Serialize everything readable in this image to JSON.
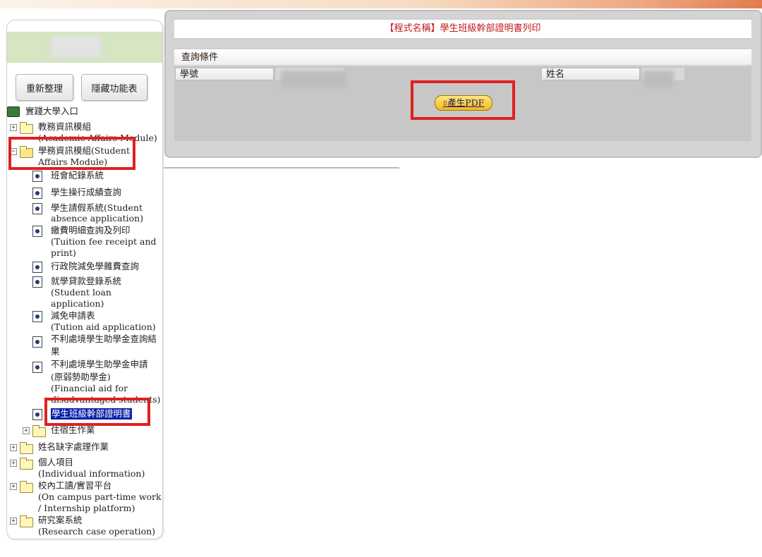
{
  "sidebar": {
    "refresh_label": "重新整理",
    "hide_menu_label": "隱藏功能表",
    "root_label": "實踐大學入口",
    "items": [
      {
        "label": "教務資訊模組",
        "sub": "(Academic Affairs Module)"
      },
      {
        "label": "學務資訊模組(Student",
        "sub": "Affairs Module)"
      },
      {
        "label": "班會紀錄系統"
      },
      {
        "label": "學生操行成績查詢"
      },
      {
        "label": "學生請假系統(Student",
        "sub": "absence application)"
      },
      {
        "label": "繳費明細查詢及列印",
        "sub": "(Tuition fee receipt and",
        "sub2": "print)"
      },
      {
        "label": "行政院減免學雜費查詢"
      },
      {
        "label": "就學貸款登錄系統",
        "sub": "(Student loan",
        "sub2": "application)"
      },
      {
        "label": "減免申請表",
        "sub": "(Tution aid application)"
      },
      {
        "label": "不利處境學生助學金查詢結",
        "sub": "果"
      },
      {
        "label": "不利處境學生助學金申請",
        "sub": "(原弱勢助學金)",
        "sub2": "(Financial aid for",
        "sub3": "disadvantaged students)"
      },
      {
        "label": "學生班級幹部證明書"
      },
      {
        "label": "住宿生作業"
      },
      {
        "label": "姓名缺字處理作業"
      },
      {
        "label": "個人項目",
        "sub": "(Individual information)"
      },
      {
        "label": "校內工讀/實習平台",
        "sub": "(On campus part-time work",
        "sub2": "/ Internship platform)"
      },
      {
        "label": "研究案系統",
        "sub": "(Research case operation)"
      }
    ]
  },
  "main": {
    "title": "【程式名稱】學生班級幹部證明書列印",
    "query_title": "查詢條件",
    "student_id_label": "學號",
    "name_label": "姓名",
    "pdf_button": "產生PDF"
  },
  "colors": {
    "highlight": "#e02020",
    "selected_bg": "#0a1fa8",
    "title_text": "#c01818"
  }
}
